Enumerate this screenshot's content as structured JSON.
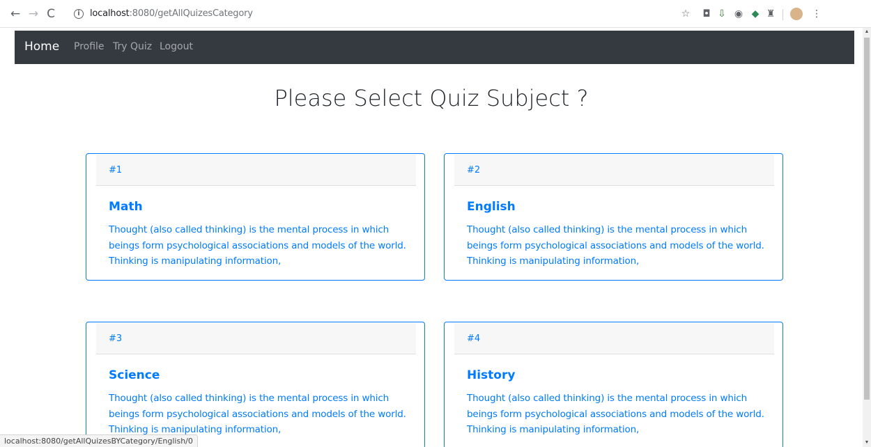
{
  "browser": {
    "url_host": "localhost",
    "url_path": ":8080/getAllQuizesCategory",
    "status_url": "localhost:8080/getAllQuizesBYCategory/English/0"
  },
  "navbar": {
    "brand": "Home",
    "links": [
      "Profile",
      "Try Quiz",
      "Logout"
    ]
  },
  "page": {
    "heading": "Please Select Quiz Subject ?"
  },
  "cards": [
    {
      "number": "#1",
      "title": "Math",
      "line1": "Thought (also called thinking) is the mental process in which",
      "line2": "beings form psychological associations and models of the world.",
      "line3": "Thinking is manipulating information,"
    },
    {
      "number": "#2",
      "title": "English",
      "line1": "Thought (also called thinking) is the mental process in which",
      "line2": "beings form psychological associations and models of the world.",
      "line3": "Thinking is manipulating information,"
    },
    {
      "number": "#3",
      "title": "Science",
      "line1": "Thought (also called thinking) is the mental process in which",
      "line2": "beings form psychological associations and models of the world.",
      "line3": "Thinking is manipulating information,"
    },
    {
      "number": "#4",
      "title": "History",
      "line1": "Thought (also called thinking) is the mental process in which",
      "line2": "beings form psychological associations and models of the world.",
      "line3": "Thinking is manipulating information,"
    }
  ],
  "colors": {
    "navbar_bg": "#343a40",
    "accent": "#007bff"
  }
}
